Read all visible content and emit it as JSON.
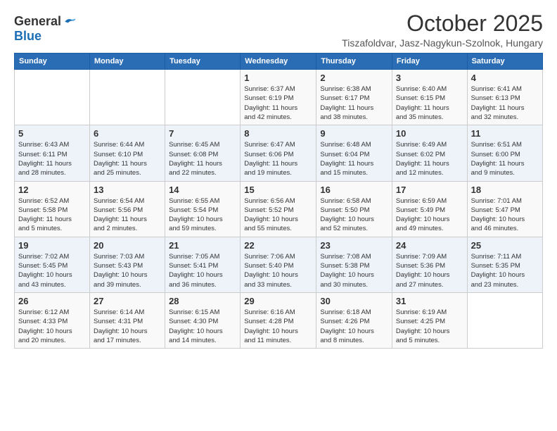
{
  "header": {
    "logo_general": "General",
    "logo_blue": "Blue",
    "month_title": "October 2025",
    "subtitle": "Tiszafoldvar, Jasz-Nagykun-Szolnok, Hungary"
  },
  "calendar": {
    "days_of_week": [
      "Sunday",
      "Monday",
      "Tuesday",
      "Wednesday",
      "Thursday",
      "Friday",
      "Saturday"
    ],
    "weeks": [
      [
        {
          "day": "",
          "info": ""
        },
        {
          "day": "",
          "info": ""
        },
        {
          "day": "",
          "info": ""
        },
        {
          "day": "1",
          "info": "Sunrise: 6:37 AM\nSunset: 6:19 PM\nDaylight: 11 hours\nand 42 minutes."
        },
        {
          "day": "2",
          "info": "Sunrise: 6:38 AM\nSunset: 6:17 PM\nDaylight: 11 hours\nand 38 minutes."
        },
        {
          "day": "3",
          "info": "Sunrise: 6:40 AM\nSunset: 6:15 PM\nDaylight: 11 hours\nand 35 minutes."
        },
        {
          "day": "4",
          "info": "Sunrise: 6:41 AM\nSunset: 6:13 PM\nDaylight: 11 hours\nand 32 minutes."
        }
      ],
      [
        {
          "day": "5",
          "info": "Sunrise: 6:43 AM\nSunset: 6:11 PM\nDaylight: 11 hours\nand 28 minutes."
        },
        {
          "day": "6",
          "info": "Sunrise: 6:44 AM\nSunset: 6:10 PM\nDaylight: 11 hours\nand 25 minutes."
        },
        {
          "day": "7",
          "info": "Sunrise: 6:45 AM\nSunset: 6:08 PM\nDaylight: 11 hours\nand 22 minutes."
        },
        {
          "day": "8",
          "info": "Sunrise: 6:47 AM\nSunset: 6:06 PM\nDaylight: 11 hours\nand 19 minutes."
        },
        {
          "day": "9",
          "info": "Sunrise: 6:48 AM\nSunset: 6:04 PM\nDaylight: 11 hours\nand 15 minutes."
        },
        {
          "day": "10",
          "info": "Sunrise: 6:49 AM\nSunset: 6:02 PM\nDaylight: 11 hours\nand 12 minutes."
        },
        {
          "day": "11",
          "info": "Sunrise: 6:51 AM\nSunset: 6:00 PM\nDaylight: 11 hours\nand 9 minutes."
        }
      ],
      [
        {
          "day": "12",
          "info": "Sunrise: 6:52 AM\nSunset: 5:58 PM\nDaylight: 11 hours\nand 5 minutes."
        },
        {
          "day": "13",
          "info": "Sunrise: 6:54 AM\nSunset: 5:56 PM\nDaylight: 11 hours\nand 2 minutes."
        },
        {
          "day": "14",
          "info": "Sunrise: 6:55 AM\nSunset: 5:54 PM\nDaylight: 10 hours\nand 59 minutes."
        },
        {
          "day": "15",
          "info": "Sunrise: 6:56 AM\nSunset: 5:52 PM\nDaylight: 10 hours\nand 55 minutes."
        },
        {
          "day": "16",
          "info": "Sunrise: 6:58 AM\nSunset: 5:50 PM\nDaylight: 10 hours\nand 52 minutes."
        },
        {
          "day": "17",
          "info": "Sunrise: 6:59 AM\nSunset: 5:49 PM\nDaylight: 10 hours\nand 49 minutes."
        },
        {
          "day": "18",
          "info": "Sunrise: 7:01 AM\nSunset: 5:47 PM\nDaylight: 10 hours\nand 46 minutes."
        }
      ],
      [
        {
          "day": "19",
          "info": "Sunrise: 7:02 AM\nSunset: 5:45 PM\nDaylight: 10 hours\nand 43 minutes."
        },
        {
          "day": "20",
          "info": "Sunrise: 7:03 AM\nSunset: 5:43 PM\nDaylight: 10 hours\nand 39 minutes."
        },
        {
          "day": "21",
          "info": "Sunrise: 7:05 AM\nSunset: 5:41 PM\nDaylight: 10 hours\nand 36 minutes."
        },
        {
          "day": "22",
          "info": "Sunrise: 7:06 AM\nSunset: 5:40 PM\nDaylight: 10 hours\nand 33 minutes."
        },
        {
          "day": "23",
          "info": "Sunrise: 7:08 AM\nSunset: 5:38 PM\nDaylight: 10 hours\nand 30 minutes."
        },
        {
          "day": "24",
          "info": "Sunrise: 7:09 AM\nSunset: 5:36 PM\nDaylight: 10 hours\nand 27 minutes."
        },
        {
          "day": "25",
          "info": "Sunrise: 7:11 AM\nSunset: 5:35 PM\nDaylight: 10 hours\nand 23 minutes."
        }
      ],
      [
        {
          "day": "26",
          "info": "Sunrise: 6:12 AM\nSunset: 4:33 PM\nDaylight: 10 hours\nand 20 minutes."
        },
        {
          "day": "27",
          "info": "Sunrise: 6:14 AM\nSunset: 4:31 PM\nDaylight: 10 hours\nand 17 minutes."
        },
        {
          "day": "28",
          "info": "Sunrise: 6:15 AM\nSunset: 4:30 PM\nDaylight: 10 hours\nand 14 minutes."
        },
        {
          "day": "29",
          "info": "Sunrise: 6:16 AM\nSunset: 4:28 PM\nDaylight: 10 hours\nand 11 minutes."
        },
        {
          "day": "30",
          "info": "Sunrise: 6:18 AM\nSunset: 4:26 PM\nDaylight: 10 hours\nand 8 minutes."
        },
        {
          "day": "31",
          "info": "Sunrise: 6:19 AM\nSunset: 4:25 PM\nDaylight: 10 hours\nand 5 minutes."
        },
        {
          "day": "",
          "info": ""
        }
      ]
    ]
  }
}
